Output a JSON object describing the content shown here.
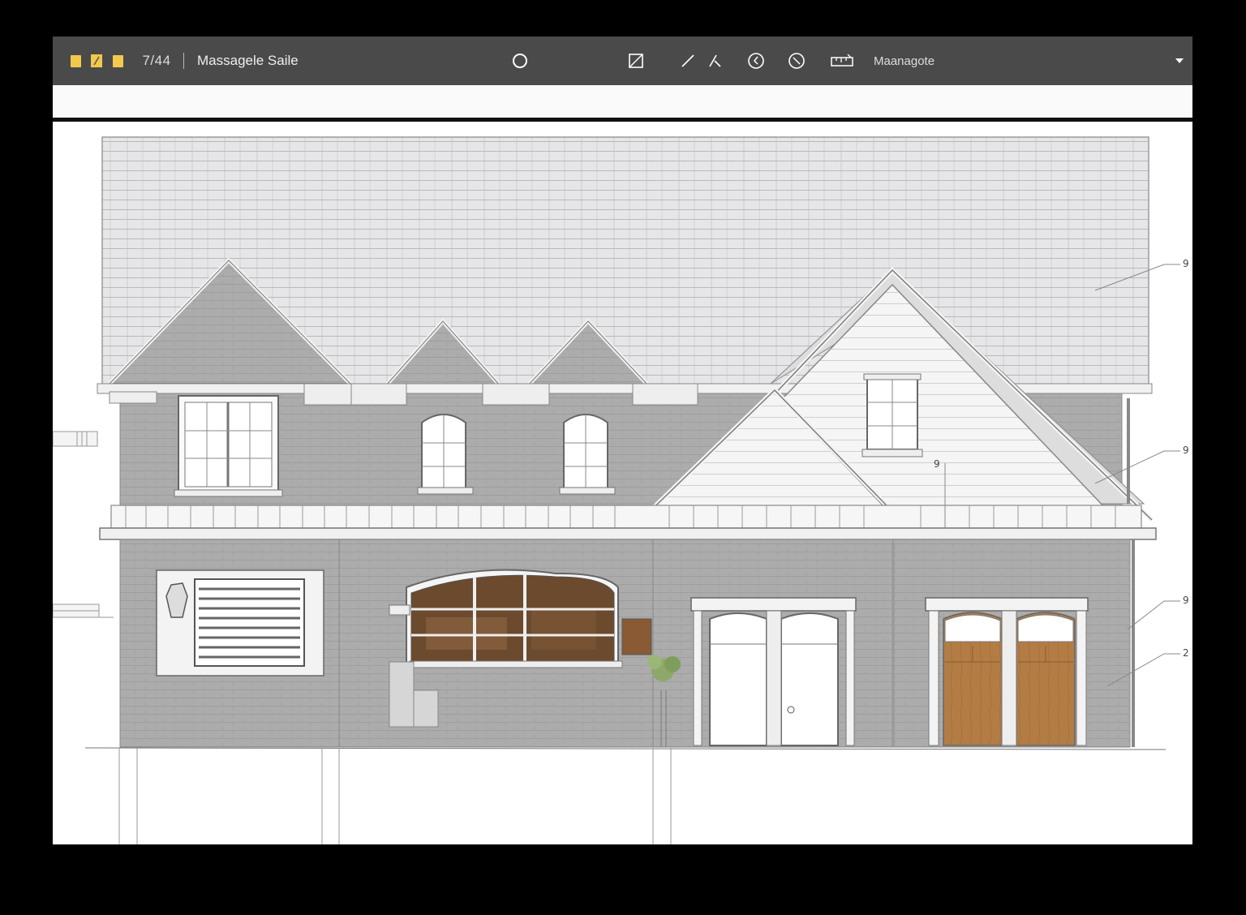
{
  "toolbar": {
    "page_counter": "7/44",
    "document_title": "Massagele Saile",
    "tool_label": "Maanagote",
    "note_colors": [
      "#f2c94c",
      "#f2c94c",
      "#f2c94c"
    ]
  },
  "drawing": {
    "callouts": [
      "9",
      "9",
      "9",
      "2",
      "9"
    ],
    "colors": {
      "brick": "#a9a9aa",
      "roof": "#d4d4d6",
      "siding": "#f4f4f4",
      "door_wood": "#b07a45",
      "window_interior": "#6b4a2e"
    }
  }
}
